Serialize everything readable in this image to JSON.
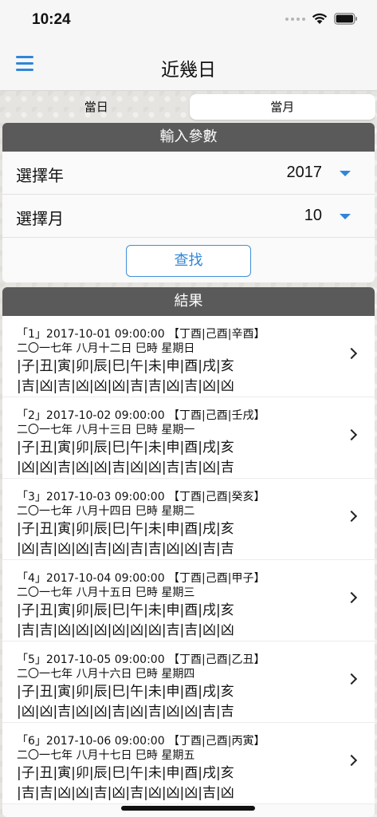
{
  "status": {
    "time": "10:24"
  },
  "nav": {
    "title": "近幾日"
  },
  "segments": [
    {
      "label": "當日",
      "active": false
    },
    {
      "label": "當月",
      "active": true
    }
  ],
  "input_panel": {
    "header": "輸入參數",
    "year_label": "選擇年",
    "year_value": "2017",
    "month_label": "選擇月",
    "month_value": "10",
    "query_button": "查找"
  },
  "result_panel": {
    "header": "結果",
    "items": [
      {
        "title": "「1」2017-10-01 09:00:00 【丁酉|己酉|辛酉】",
        "lunar": "二〇一七年 八月十二日 巳時 星期日",
        "branches": "|子|丑|寅|卯|辰|巳|午|未|申|酉|戌|亥",
        "luck": "|吉|凶|吉|凶|凶|凶|吉|吉|凶|吉|凶|凶"
      },
      {
        "title": "「2」2017-10-02 09:00:00 【丁酉|己酉|壬戌】",
        "lunar": "二〇一七年 八月十三日 巳時 星期一",
        "branches": "|子|丑|寅|卯|辰|巳|午|未|申|酉|戌|亥",
        "luck": "|凶|凶|吉|凶|凶|吉|凶|凶|吉|吉|凶|吉"
      },
      {
        "title": "「3」2017-10-03 09:00:00 【丁酉|己酉|癸亥】",
        "lunar": "二〇一七年 八月十四日 巳時 星期二",
        "branches": "|子|丑|寅|卯|辰|巳|午|未|申|酉|戌|亥",
        "luck": "|凶|吉|凶|凶|吉|凶|吉|吉|凶|凶|吉|吉"
      },
      {
        "title": "「4」2017-10-04 09:00:00 【丁酉|己酉|甲子】",
        "lunar": "二〇一七年 八月十五日 巳時 星期三",
        "branches": "|子|丑|寅|卯|辰|巳|午|未|申|酉|戌|亥",
        "luck": "|吉|吉|凶|凶|凶|凶|凶|凶|吉|吉|凶|凶"
      },
      {
        "title": "「5」2017-10-05 09:00:00 【丁酉|己酉|乙丑】",
        "lunar": "二〇一七年 八月十六日 巳時 星期四",
        "branches": "|子|丑|寅|卯|辰|巳|午|未|申|酉|戌|亥",
        "luck": "|凶|凶|吉|凶|凶|吉|凶|吉|凶|凶|吉|吉"
      },
      {
        "title": "「6」2017-10-06 09:00:00 【丁酉|己酉|丙寅】",
        "lunar": "二〇一七年 八月十七日 巳時 星期五",
        "branches": "|子|丑|寅|卯|辰|巳|午|未|申|酉|戌|亥",
        "luck": "|吉|吉|凶|凶|吉|凶|吉|凶|凶|凶|吉|凶"
      }
    ]
  },
  "colors": {
    "accent": "#2f86d9",
    "header_bg": "#5a5a5a"
  },
  "icons": [
    "menu-icon",
    "wifi-icon",
    "battery-icon",
    "chevron-right-icon",
    "dropdown-arrow-icon"
  ]
}
